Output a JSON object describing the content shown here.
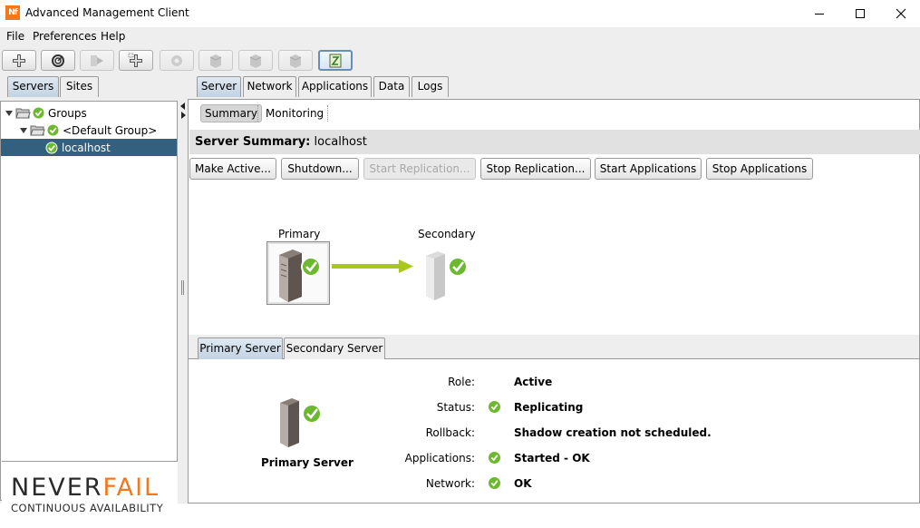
{
  "window": {
    "app_icon_text": "Nf",
    "title": "Advanced Management Client"
  },
  "menu": {
    "items": [
      "File",
      "Preferences",
      "Help"
    ]
  },
  "toolbar": {
    "buttons": [
      {
        "icon": "add-server-icon",
        "enabled": true
      },
      {
        "icon": "discover-icon",
        "enabled": true
      },
      {
        "icon": "move-icon",
        "enabled": false
      },
      {
        "icon": "add-group-icon",
        "enabled": true
      },
      {
        "icon": "settings-disabled-icon",
        "enabled": false
      },
      {
        "icon": "server-disabled-icon",
        "enabled": false
      },
      {
        "icon": "server-disabled-icon",
        "enabled": false
      },
      {
        "icon": "server-disabled-icon",
        "enabled": false
      },
      {
        "icon": "map-icon",
        "enabled": true,
        "active": true
      }
    ]
  },
  "left_panel": {
    "tabs": [
      {
        "label": "Servers",
        "selected": true
      },
      {
        "label": "Sites",
        "selected": false
      }
    ],
    "tree": [
      {
        "label": "Groups",
        "level": 0,
        "expanded": true
      },
      {
        "label": "<Default Group>",
        "level": 1,
        "expanded": true
      },
      {
        "label": "localhost",
        "level": 2,
        "selected": true
      }
    ],
    "logo": {
      "word_a": "NEVER",
      "word_b": "FAIL",
      "tagline": "CONTINUOUS AVAILABILITY"
    }
  },
  "right_panel": {
    "tabs": [
      {
        "label": "Server",
        "selected": true
      },
      {
        "label": "Network",
        "selected": false
      },
      {
        "label": "Applications",
        "selected": false
      },
      {
        "label": "Data",
        "selected": false
      },
      {
        "label": "Logs",
        "selected": false
      }
    ],
    "subtabs": [
      {
        "label": "Summary",
        "selected": true
      },
      {
        "label": "Monitoring",
        "selected": false
      }
    ],
    "summary": {
      "title": "Server Summary:",
      "server_name": "localhost"
    },
    "actions": [
      {
        "label": "Make Active...",
        "enabled": true
      },
      {
        "label": "Shutdown...",
        "enabled": true
      },
      {
        "label": "Start Replication...",
        "enabled": false
      },
      {
        "label": "Stop Replication...",
        "enabled": true
      },
      {
        "label": "Start Applications",
        "enabled": true
      },
      {
        "label": "Stop Applications",
        "enabled": true
      }
    ],
    "diagram": {
      "primary_label": "Primary",
      "secondary_label": "Secondary",
      "arrow_color": "#a8c81e"
    },
    "lower_tabs": [
      {
        "label": "Primary Server",
        "selected": true
      },
      {
        "label": "Secondary Server",
        "selected": false
      }
    ],
    "details": {
      "server_label": "Primary Server",
      "properties": [
        {
          "label": "Role:",
          "value": "Active",
          "check": false
        },
        {
          "label": "Status:",
          "value": "Replicating",
          "check": true
        },
        {
          "label": "Rollback:",
          "value": "Shadow creation not scheduled.",
          "check": false
        },
        {
          "label": "Applications:",
          "value": "Started - OK",
          "check": true
        },
        {
          "label": "Network:",
          "value": "OK",
          "check": true
        }
      ]
    }
  },
  "colors": {
    "ok_green": "#6cb82e",
    "selection_blue": "#33607f",
    "brand_orange": "#f0781e"
  }
}
